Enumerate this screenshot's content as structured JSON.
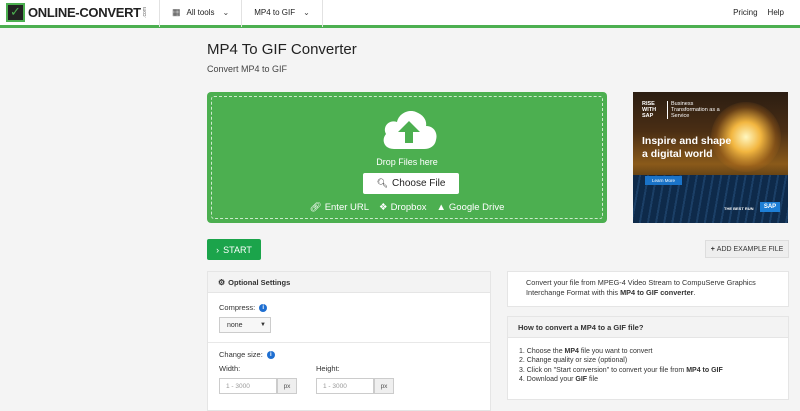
{
  "header": {
    "logo_text_1": "ONLINE-",
    "logo_text_2": "CONVERT",
    "logo_com": ".com",
    "nav": [
      {
        "label": "All tools",
        "icon": "grid-icon"
      },
      {
        "label": "MP4 to GIF"
      }
    ],
    "right_links": [
      "Pricing",
      "Help"
    ],
    "accent_color": "#4caf50"
  },
  "page": {
    "title": "MP4 To GIF Converter",
    "subtitle": "Convert MP4 to GIF"
  },
  "upload": {
    "drop_text": "Drop Files here",
    "choose_label": "Choose File",
    "sources": [
      "Enter URL",
      "Dropbox",
      "Google Drive"
    ],
    "bg_color": "#4caf50"
  },
  "ad": {
    "rise": "RISE WITH SAP",
    "tagline": "Business Transformation as a Service",
    "headline_1": "Inspire and shape",
    "headline_2": "a digital world",
    "button": "Learn More",
    "best_run": "THE BEST RUN",
    "sap": "SAP"
  },
  "actions": {
    "start_label": "START",
    "add_example_label": "ADD EXAMPLE FILE"
  },
  "options": {
    "heading": "Optional Settings",
    "compress_label": "Compress:",
    "compress_value": "none",
    "change_size_label": "Change size:",
    "width_label": "Width:",
    "height_label": "Height:",
    "width_placeholder": "1 - 3000",
    "height_placeholder": "1 - 3000",
    "unit": "px"
  },
  "description": {
    "text_1": "Convert your file from MPEG-4 Video Stream to CompuServe Graphics Interchange Format with this ",
    "text_bold": "MP4 to GIF converter",
    "text_2": "."
  },
  "howto": {
    "heading": "How to convert a MP4 to a GIF file?",
    "step1_a": "1. Choose the ",
    "step1_b": "MP4",
    "step1_c": " file you want to convert",
    "step2": "2. Change quality or size (optional)",
    "step3_a": "3. Click on \"Start conversion\" to convert your file from ",
    "step3_b": "MP4 to GIF",
    "step4_a": "4. Download your ",
    "step4_b": "GIF",
    "step4_c": " file"
  }
}
